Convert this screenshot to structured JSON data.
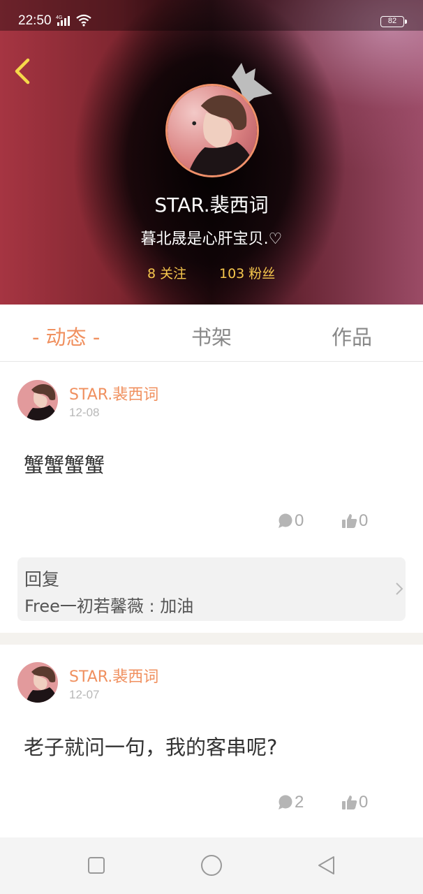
{
  "status_bar": {
    "time": "22:50",
    "network": "4G",
    "battery": "82"
  },
  "profile": {
    "name": "STAR.裴西词",
    "bio": "暮北晟是心肝宝贝.♡",
    "following": "8 关注",
    "followers": "103 粉丝"
  },
  "tabs": [
    {
      "label": "- 动态 -",
      "active": true
    },
    {
      "label": "书架",
      "active": false
    },
    {
      "label": "作品",
      "active": false
    }
  ],
  "posts": [
    {
      "author": "STAR.裴西词",
      "date": "12-08",
      "content": "蟹蟹蟹蟹",
      "comments": "0",
      "likes": "0",
      "reply": {
        "title": "回复",
        "text": "Free一初若馨薇 : 加油"
      }
    },
    {
      "author": "STAR.裴西词",
      "date": "12-07",
      "content": "老子就问一句，我的客串呢?",
      "comments": "2",
      "likes": "0"
    }
  ],
  "colors": {
    "accent": "#f0905f",
    "stats": "#f6c74d",
    "avatar_ring": "#f0916a"
  },
  "icons": {
    "back": "back-arrow-icon",
    "crown": "crown-icon",
    "comment": "comment-icon",
    "like": "thumbs-up-icon",
    "chevron": "chevron-right-icon"
  }
}
